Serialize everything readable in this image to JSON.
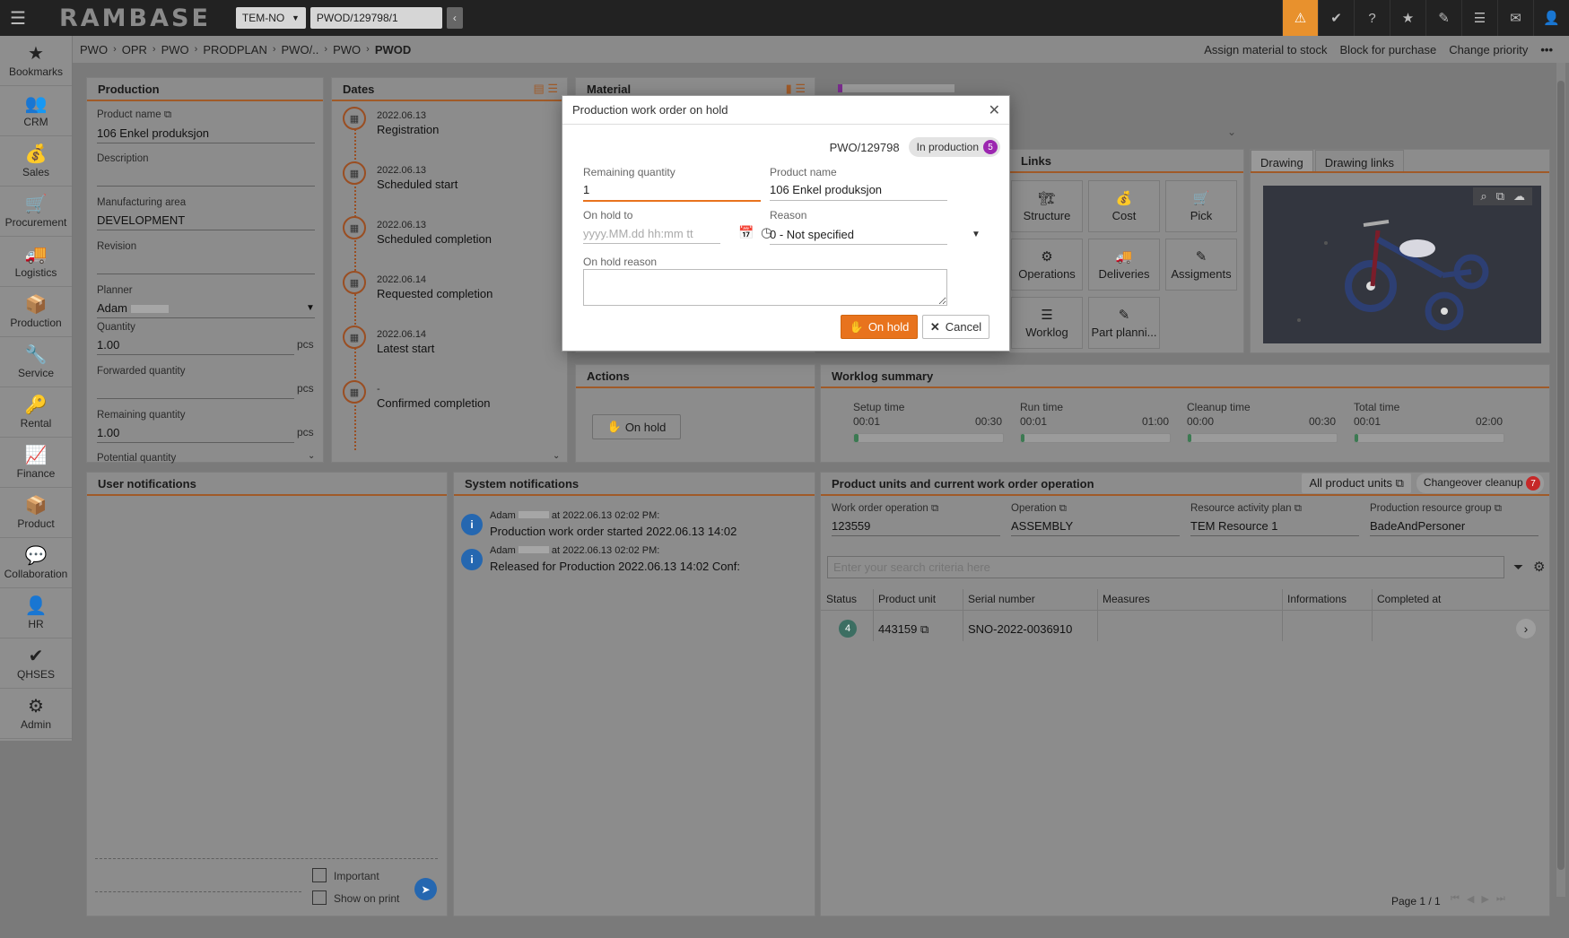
{
  "app": {
    "logo": "RAMBASE",
    "company": "TEM-NO",
    "document": "PWOD/129798/1"
  },
  "sidebar": [
    {
      "label": "Bookmarks",
      "icon": "★"
    },
    {
      "label": "CRM",
      "icon": "👥"
    },
    {
      "label": "Sales",
      "icon": "💰"
    },
    {
      "label": "Procurement",
      "icon": "🛒"
    },
    {
      "label": "Logistics",
      "icon": "🚚"
    },
    {
      "label": "Production",
      "icon": "📦"
    },
    {
      "label": "Service",
      "icon": "🔧"
    },
    {
      "label": "Rental",
      "icon": "🔑"
    },
    {
      "label": "Finance",
      "icon": "📈"
    },
    {
      "label": "Product",
      "icon": "📦"
    },
    {
      "label": "Collaboration",
      "icon": "💬"
    },
    {
      "label": "HR",
      "icon": "👤"
    },
    {
      "label": "QHSES",
      "icon": "✔"
    },
    {
      "label": "Admin",
      "icon": "⚙"
    }
  ],
  "breadcrumb": [
    "PWO",
    "OPR",
    "PWO",
    "PRODPLAN",
    "PWO/..",
    "PWO",
    "PWOD"
  ],
  "actions": {
    "assign": "Assign material to stock",
    "block": "Block for purchase",
    "priority": "Change priority",
    "more": "•••"
  },
  "production": {
    "title": "Production",
    "product_name_label": "Product name",
    "product_name": "106 Enkel produksjon",
    "description_label": "Description",
    "area_label": "Manufacturing area",
    "area": "DEVELOPMENT",
    "revision_label": "Revision",
    "planner_label": "Planner",
    "planner": "Adam",
    "quantity_label": "Quantity",
    "quantity": "1.00",
    "forwarded_label": "Forwarded quantity",
    "remaining_label": "Remaining quantity",
    "remaining": "1.00",
    "potential_label": "Potential quantity",
    "unit": "pcs"
  },
  "dates": {
    "title": "Dates",
    "items": [
      {
        "date": "2022.06.13",
        "name": "Registration"
      },
      {
        "date": "2022.06.13",
        "name": "Scheduled start"
      },
      {
        "date": "2022.06.13",
        "name": "Scheduled completion"
      },
      {
        "date": "2022.06.14",
        "name": "Requested completion"
      },
      {
        "date": "2022.06.14",
        "name": "Latest start"
      },
      {
        "date": "-",
        "name": "Confirmed completion"
      }
    ]
  },
  "material": {
    "title": "Material"
  },
  "links": {
    "title": "Links",
    "tiles": [
      {
        "label": "Structure",
        "icon": "🏗"
      },
      {
        "label": "Cost",
        "icon": "💰"
      },
      {
        "label": "Pick",
        "icon": "🛒"
      },
      {
        "label": "Operations",
        "icon": "⚙"
      },
      {
        "label": "Deliveries",
        "icon": "🚚"
      },
      {
        "label": "Assigments",
        "icon": "✎"
      },
      {
        "label": "Worklog",
        "icon": "☰"
      },
      {
        "label": "Part planni...",
        "icon": "✎"
      }
    ]
  },
  "drawing": {
    "tab1": "Drawing",
    "tab2": "Drawing links"
  },
  "actions_panel": {
    "title": "Actions",
    "on_hold": "On hold"
  },
  "worklog": {
    "title": "Worklog summary",
    "items": [
      {
        "label": "Setup time",
        "start": "00:01",
        "end": "00:30",
        "progress": 0.03
      },
      {
        "label": "Run time",
        "start": "00:01",
        "end": "01:00",
        "progress": 0.02
      },
      {
        "label": "Cleanup time",
        "start": "00:00",
        "end": "00:30",
        "progress": 0.0
      },
      {
        "label": "Total time",
        "start": "00:01",
        "end": "02:00",
        "progress": 0.02
      }
    ]
  },
  "user_notifications": {
    "title": "User notifications",
    "important": "Important",
    "show_on_print": "Show on print"
  },
  "system_notifications": {
    "title": "System notifications",
    "items": [
      {
        "meta_user": "Adam",
        "meta_time": "at 2022.06.13 02:02 PM:",
        "text": "Production work order started 2022.06.13 14:02"
      },
      {
        "meta_user": "Adam",
        "meta_time": "at 2022.06.13 02:02 PM:",
        "text": "Released for Production 2022.06.13 14:02 Conf:"
      }
    ]
  },
  "product_units": {
    "title": "Product units and current work order operation",
    "all_units": "All product units",
    "changeover": "Changeover cleanup",
    "changeover_count": "7",
    "wo_op_label": "Work order operation",
    "wo_op": "123559",
    "op_label": "Operation",
    "op": "ASSEMBLY",
    "rap_label": "Resource activity plan",
    "rap": "TEM Resource 1",
    "prg_label": "Production resource group",
    "prg": "BadeAndPersoner",
    "search_placeholder": "Enter your search criteria here",
    "columns": [
      "Status",
      "Product unit",
      "Serial number",
      "Measures",
      "Informations",
      "Completed at"
    ],
    "rows": [
      {
        "status": "4",
        "unit": "443159",
        "serial": "SNO-2022-0036910",
        "measures": "",
        "info": "",
        "completed": ""
      }
    ],
    "page": "Page 1 / 1"
  },
  "dialog": {
    "title": "Production work order on hold",
    "doc": "PWO/129798",
    "status": "In production",
    "status_count": "5",
    "remaining_label": "Remaining quantity",
    "remaining": "1",
    "product_label": "Product name",
    "product": "106 Enkel produksjon",
    "hold_to_label": "On hold to",
    "hold_to_placeholder": "yyyy.MM.dd hh:mm tt",
    "reason_label": "Reason",
    "reason": "0 - Not specified",
    "hold_reason_label": "On hold reason",
    "ok": "On hold",
    "cancel": "Cancel"
  },
  "colors": {
    "accent": "#e8731d",
    "header_line": "#a05a28",
    "status_purple": "#9c27b0",
    "badge_red": "#c62828",
    "status_green": "#3c7a52"
  }
}
